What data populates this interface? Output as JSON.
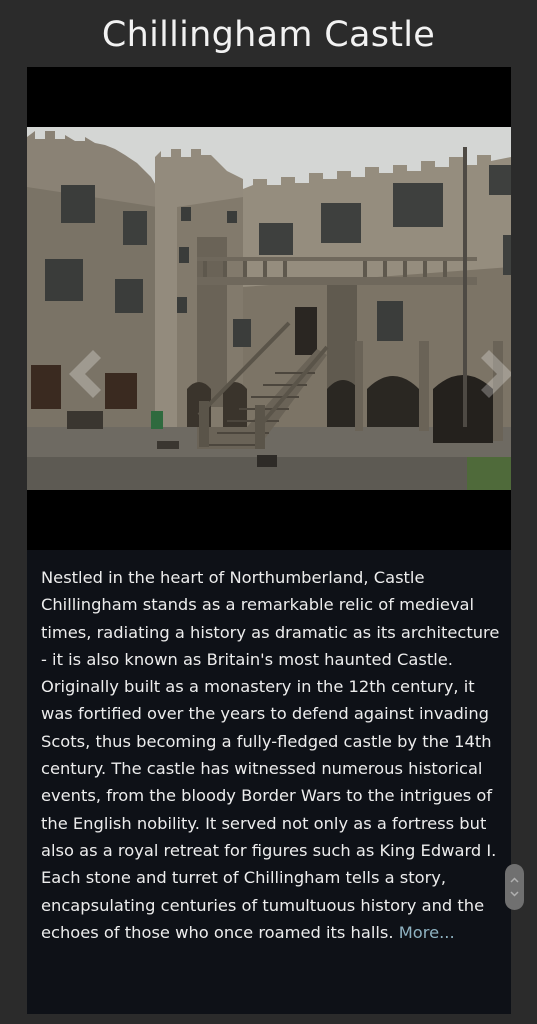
{
  "page": {
    "title": "Chillingham Castle"
  },
  "gallery": {
    "prev_icon": "chevron-left-icon",
    "next_icon": "chevron-right-icon"
  },
  "description": {
    "text": "Nestled in the heart of Northumberland, Castle Chillingham stands as a remarkable relic of medieval times, radiating a history as dramatic as its architecture - it is also known as Britain's most haunted Castle. Originally built as a monastery in the 12th century, it was fortified over the years to defend against invading Scots, thus becoming a fully-fledged castle by the 14th century. The castle has witnessed numerous historical events, from the bloody Border Wars to the intrigues of the English nobility. It served not only as a fortress but also as a royal retreat for figures such as King Edward I. Each stone and turret of Chillingham tells a story, encapsulating centuries of tumultuous history and the echoes of those who once roamed its halls.",
    "more_label": "More..."
  },
  "scrollbar": {
    "icon": "scroll-handle-icon"
  },
  "colors": {
    "background": "#2b2b2b",
    "panel": "#0e1117",
    "link": "#8fb3c2",
    "text": "#ededed"
  }
}
